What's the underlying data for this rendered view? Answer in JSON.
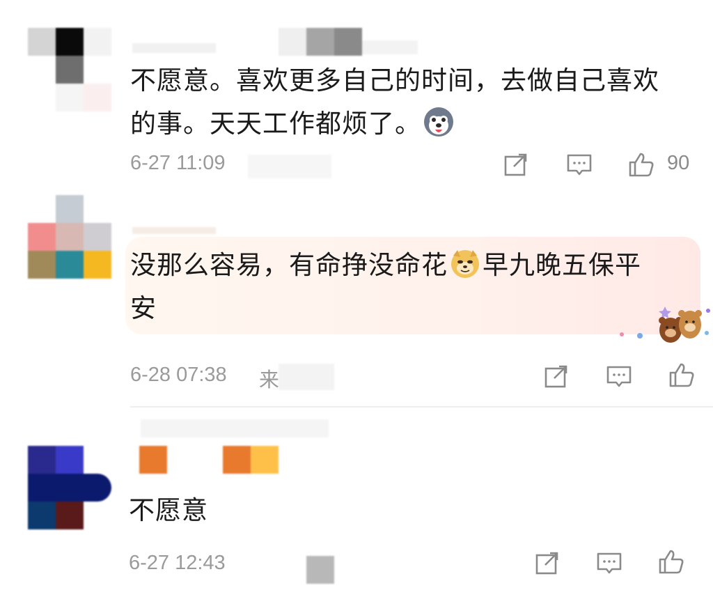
{
  "comments": [
    {
      "text_line1": "不愿意。喜欢更多自己的时间，去做自己喜欢",
      "text_line2": "的事。天天工作都烦了。",
      "time": "6-27 11:09",
      "like_count": "90",
      "emoji": "husky-dog-emoji"
    },
    {
      "text_line1a": "没那么容易，有命挣没命花",
      "text_line1b": "早九晚五保平",
      "text_line2": "安",
      "time": "6-28 07:38",
      "time_suffix": "来",
      "emoji": "doge-emoji",
      "bubble_decoration": "bear-couple-sticker"
    },
    {
      "text_line1": "不愿意",
      "time": "6-27 12:43"
    }
  ],
  "icons": {
    "share": "share-icon",
    "reply": "reply-icon",
    "like": "thumbs-up-icon"
  },
  "colors": {
    "text": "#1a1a1a",
    "meta": "#9a9a9a",
    "icon": "#8a8a8a",
    "bubble": "#fff1ec",
    "badge_orange": "#e87a2e",
    "badge_yellow": "#ffc04a"
  }
}
